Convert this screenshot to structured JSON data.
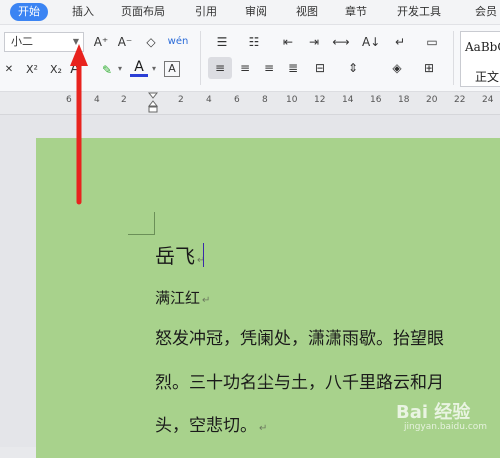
{
  "tabs": [
    "开始",
    "插入",
    "页面布局",
    "引用",
    "审阅",
    "视图",
    "章节",
    "开发工具",
    "会员"
  ],
  "font_size": {
    "value": "小二"
  },
  "ribbon": {
    "grow_font": "A⁺",
    "shrink_font": "A⁻",
    "clear_format": "◇",
    "pinyin": "wén",
    "superscript": "X²",
    "subscript": "X₂",
    "text_effect": "A",
    "highlight": "✎",
    "font_color": "A",
    "char_border": "A",
    "styles_preview_1": "AaBbC",
    "styles_preview_2": "正文"
  },
  "ruler": [
    "6",
    "4",
    "2",
    "2",
    "4",
    "6",
    "8",
    "10",
    "12",
    "14",
    "16",
    "18",
    "20",
    "22",
    "24"
  ],
  "document": {
    "title": "岳飞",
    "subtitle": "满江红",
    "lines": [
      "怒发冲冠，凭阑处，潇潇雨歇。抬望眼",
      "烈。三十功名尘与土，八千里路云和月",
      "头，空悲切。"
    ],
    "paragraph_mark": "↵"
  },
  "watermark": {
    "main": "Bai 经验",
    "sub": "jingyan.baidu.com"
  },
  "colors": {
    "accent": "#3b84f3",
    "page_bg": "#a8d28c",
    "arrow": "#e8231e"
  }
}
